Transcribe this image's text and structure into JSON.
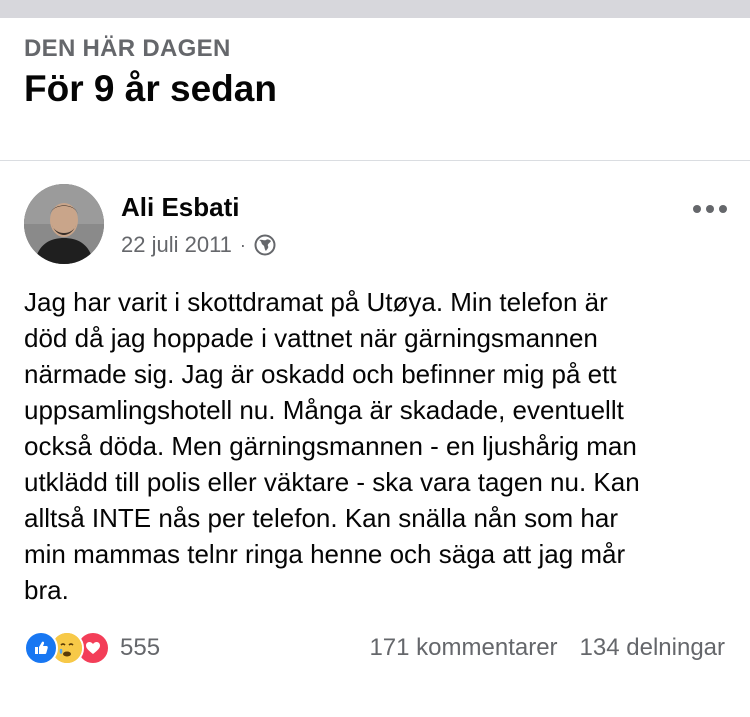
{
  "memory": {
    "label": "DEN HÄR DAGEN",
    "title": "För 9 år sedan"
  },
  "post": {
    "author": "Ali Esbati",
    "date": "22 juli 2011",
    "separator": "·",
    "privacy_icon": "globe-icon",
    "more_icon": "more-options-icon",
    "text": "Jag har varit i skottdramat på Utøya. Min telefon är\ndöd då jag hoppade i vattnet när gärningsmannen\nnärmade sig. Jag är oskadd och befinner mig på ett\nuppsamlingshotell nu. Många är skadade, eventuellt\nockså döda. Men gärningsmannen - en ljushårig man\nutklädd till polis eller väktare - ska vara tagen nu. Kan\nalltså INTE nås per telefon. Kan snälla nån som har\nmin mammas telnr ringa henne och säga att jag mår\nbra."
  },
  "engagement": {
    "reaction_icons": [
      "like-reaction-icon",
      "care-reaction-icon",
      "love-reaction-icon"
    ],
    "reaction_count": "555",
    "comments": "171 kommentarer",
    "shares": "134 delningar"
  },
  "colors": {
    "like_blue": "#1877f2",
    "love_red": "#f33e58",
    "care_yellow": "#f7b125",
    "secondary_text": "#65676b"
  }
}
